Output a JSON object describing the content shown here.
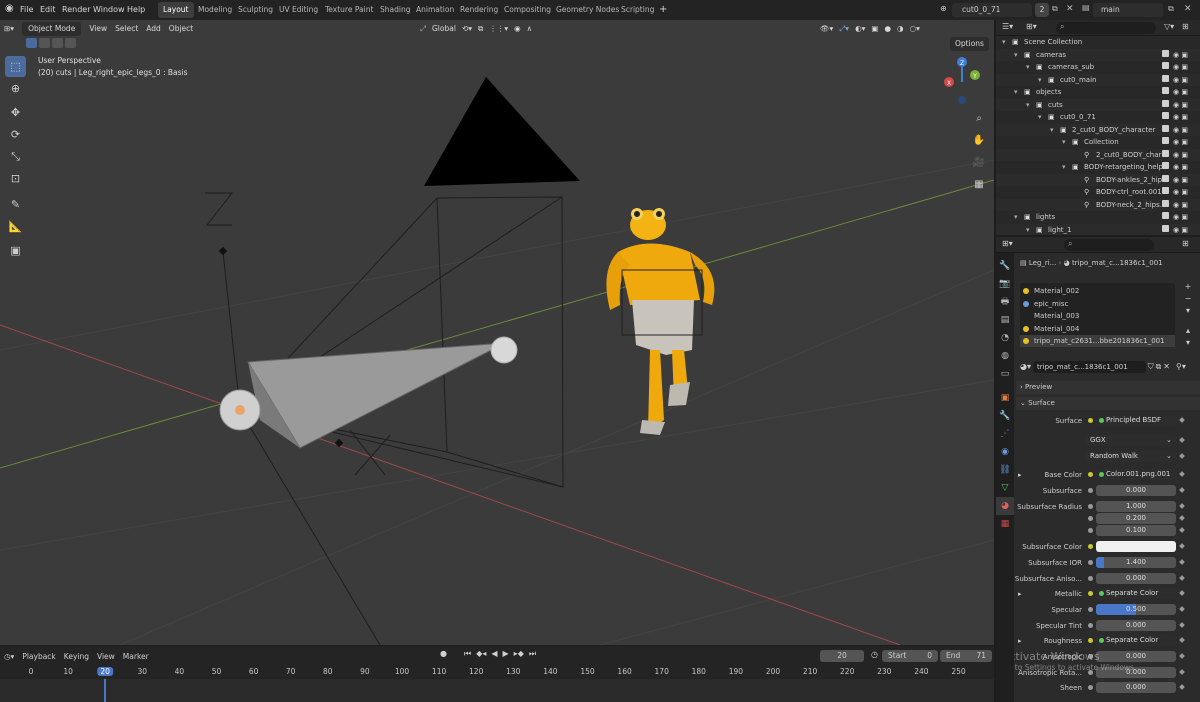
{
  "topbar": {
    "menus": [
      "File",
      "Edit",
      "Render",
      "Window",
      "Help"
    ],
    "workspaces": [
      "Layout",
      "Modeling",
      "Sculpting",
      "UV Editing",
      "Texture Paint",
      "Shading",
      "Animation",
      "Rendering",
      "Compositing",
      "Geometry Nodes",
      "Scripting"
    ],
    "active_workspace": "Layout",
    "add_tab": "+",
    "scene_name": "cut0_0_71",
    "user_count": "2",
    "view_layer": "main"
  },
  "viewport": {
    "mode": "Object Mode",
    "menus": [
      "View",
      "Select",
      "Add",
      "Object"
    ],
    "transform": "Global",
    "options": "Options",
    "perspective": "User Perspective",
    "info": "(20) cuts | Leg_right_epic_legs_0 : Basis",
    "gizmo_labels": {
      "x": "X",
      "y": "Y",
      "z": "Z"
    }
  },
  "outliner": {
    "search_placeholder": "",
    "rows": [
      {
        "label": "Scene Collection",
        "indent": 0
      },
      {
        "label": "cameras",
        "indent": 1
      },
      {
        "label": "cameras_sub",
        "indent": 2
      },
      {
        "label": "cut0_main",
        "indent": 3
      },
      {
        "label": "objects",
        "indent": 1
      },
      {
        "label": "cuts",
        "indent": 2
      },
      {
        "label": "cut0_0_71",
        "indent": 3
      },
      {
        "label": "2_cut0_BODY_character",
        "indent": 4
      },
      {
        "label": "Collection",
        "indent": 5
      },
      {
        "label": "2_cut0_BODY_char",
        "indent": 6
      },
      {
        "label": "BODY-retargeting_helpe",
        "indent": 5
      },
      {
        "label": "BODY-ankles_2_hip",
        "indent": 6
      },
      {
        "label": "BODY-ctrl_root.001",
        "indent": 6
      },
      {
        "label": "BODY-neck_2_hips.",
        "indent": 6
      },
      {
        "label": "lights",
        "indent": 1
      },
      {
        "label": "light_1",
        "indent": 2
      }
    ]
  },
  "properties": {
    "breadcrumb_object": "Leg_ri...",
    "breadcrumb_material": "tripo_mat_c...1836c1_001",
    "material_slots": [
      "Material_002",
      "epic_misc",
      "Material_003",
      "Material_004",
      "tripo_mat_c2631...bbe201836c1_001"
    ],
    "material_name": "tripo_mat_c...1836c1_001",
    "panels": {
      "preview": "Preview",
      "surface": "Surface"
    },
    "fields": [
      {
        "label": "Surface",
        "value": "Principled BSDF",
        "kind": "link"
      },
      {
        "label": "",
        "value": "GGX",
        "kind": "dropdown"
      },
      {
        "label": "",
        "value": "Random Walk",
        "kind": "dropdown"
      },
      {
        "label": "Base Color",
        "value": "Color.001.png.001",
        "kind": "link"
      },
      {
        "label": "Subsurface",
        "value": "0.000",
        "kind": "num"
      },
      {
        "label": "Subsurface Radius",
        "value": "1.000",
        "kind": "num"
      },
      {
        "label": "",
        "value": "0.200",
        "kind": "num"
      },
      {
        "label": "",
        "value": "0.100",
        "kind": "num"
      },
      {
        "label": "Subsurface Color",
        "value": "",
        "kind": "color"
      },
      {
        "label": "Subsurface IOR",
        "value": "1.400",
        "kind": "num"
      },
      {
        "label": "Subsurface Aniso...",
        "value": "0.000",
        "kind": "num"
      },
      {
        "label": "Metallic",
        "value": "Separate Color",
        "kind": "link"
      },
      {
        "label": "Specular",
        "value": "0.500",
        "kind": "slider"
      },
      {
        "label": "Specular Tint",
        "value": "0.000",
        "kind": "num"
      },
      {
        "label": "Roughness",
        "value": "Separate Color",
        "kind": "link"
      },
      {
        "label": "Anisotropic",
        "value": "0.000",
        "kind": "num"
      },
      {
        "label": "Anisotropic Rota...",
        "value": "0.000",
        "kind": "num"
      },
      {
        "label": "Sheen",
        "value": "0.000",
        "kind": "num"
      }
    ],
    "watermark_line1": "Activate Windows",
    "watermark_line2": "Go to Settings to activate Windows."
  },
  "timeline": {
    "menus": [
      "Playback",
      "Keying",
      "View",
      "Marker"
    ],
    "current_frame": "20",
    "start_label": "Start",
    "start": "0",
    "end_label": "End",
    "end": "71",
    "ticks": [
      "0",
      "10",
      "20",
      "30",
      "40",
      "50",
      "60",
      "70",
      "80",
      "90",
      "100",
      "110",
      "120",
      "130",
      "140",
      "150",
      "160",
      "170",
      "180",
      "190",
      "200",
      "210",
      "220",
      "230",
      "240",
      "250"
    ]
  }
}
